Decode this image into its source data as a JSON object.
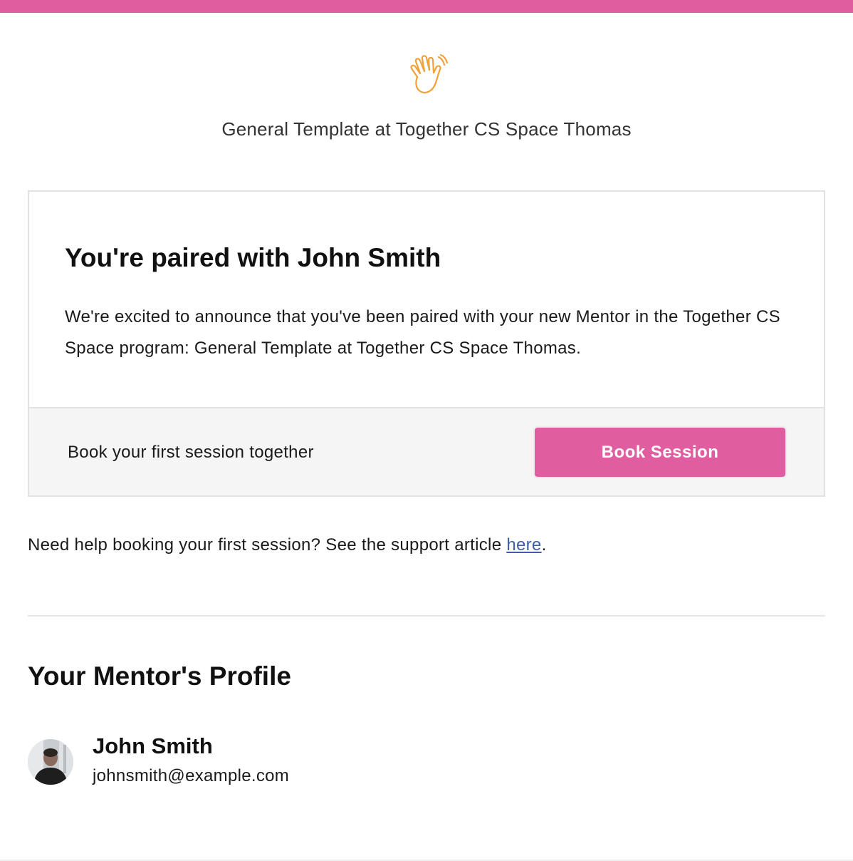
{
  "header": {
    "accent_color": "#e05d9f",
    "icon": "waving-hand-icon",
    "org_title": "General Template at Together CS Space Thomas"
  },
  "card": {
    "heading": "You're paired with John Smith",
    "body": "We're excited to announce that you've been paired with your new Mentor in the Together CS Space program: General Template at Together CS Space Thomas.",
    "footer_text": "Book your first session together",
    "button_label": "Book Session"
  },
  "help": {
    "prefix": "Need help booking your first session? See the support article ",
    "link_text": "here",
    "suffix": "."
  },
  "profile": {
    "heading": "Your Mentor's Profile",
    "name": "John Smith",
    "email": "johnsmith@example.com",
    "avatar_icon": "avatar-photo"
  },
  "colors": {
    "link": "#3f5ea8",
    "card_footer_bg": "#f5f5f5",
    "icon_stroke": "#f0a23a"
  }
}
